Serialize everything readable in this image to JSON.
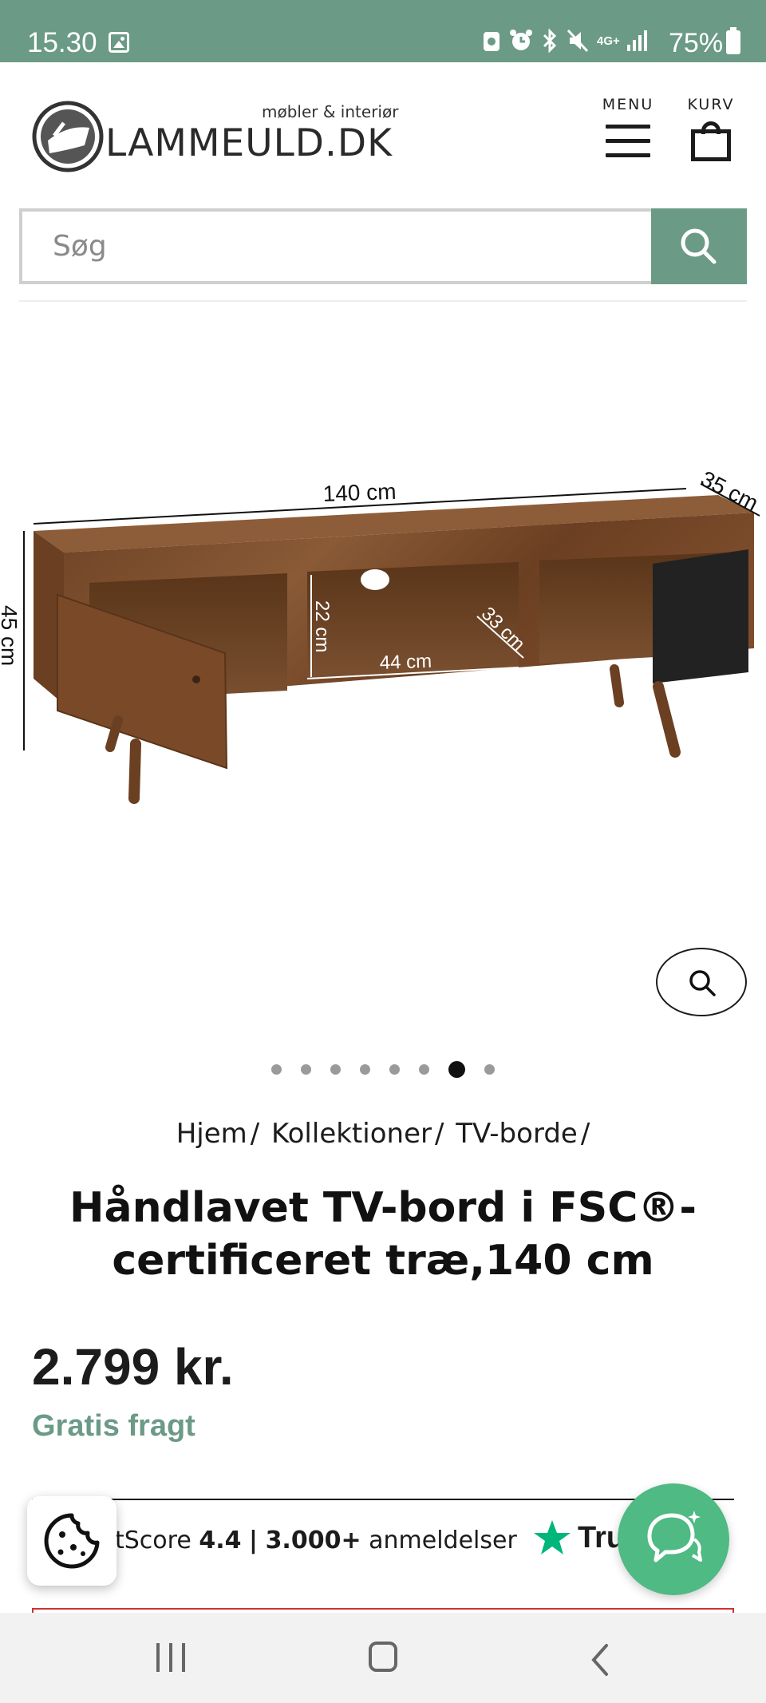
{
  "status_bar": {
    "time": "15.30",
    "network": "4G+",
    "battery": "75%"
  },
  "header": {
    "logo_name": "LAMMEULD.DK",
    "logo_tagline": "møbler & interiør",
    "menu_label": "MENU",
    "cart_label": "KURV"
  },
  "search": {
    "placeholder": "Søg",
    "value": ""
  },
  "product_image": {
    "labels": {
      "width": "140 cm",
      "depth": "35 cm",
      "height": "45 cm",
      "compartment_height": "22 cm",
      "compartment_width": "44 cm",
      "compartment_depth": "33 cm"
    }
  },
  "gallery": {
    "total_images": 8,
    "active_index": 6
  },
  "breadcrumb": [
    "Hjem",
    "Kollektioner",
    "TV-borde"
  ],
  "breadcrumb_separator": "/",
  "product": {
    "title": "Håndlavet TV-bord i FSC®-certificeret træ,140 cm",
    "price": "2.799 kr.",
    "shipping": "Gratis fragt"
  },
  "trust": {
    "score_label": "tScore",
    "score": "4.4",
    "score_separator": "|",
    "reviews_count": "3.000+",
    "reviews_label": "anmeldelser",
    "brand": "Tru"
  },
  "colors": {
    "brand_green": "#6b9a87",
    "chat_green": "#4fba83",
    "trustpilot_green": "#00b67a"
  },
  "icons": {
    "search": "search-icon",
    "zoom": "zoom-icon",
    "cookie": "cookie-icon",
    "chat": "chat-icon",
    "menu": "hamburger-icon",
    "cart": "shopping-bag-icon"
  }
}
